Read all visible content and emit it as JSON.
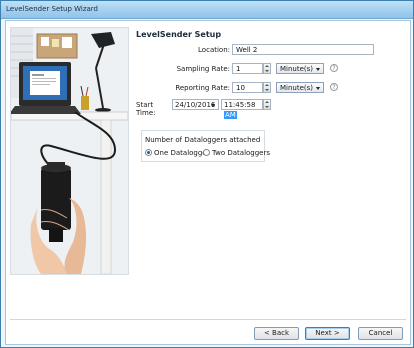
{
  "window": {
    "title": "LevelSender Setup Wizard"
  },
  "page": {
    "heading": "LevelSender Setup"
  },
  "form": {
    "location": {
      "label": "Location:",
      "value": "Well 2"
    },
    "sampling_rate": {
      "label": "Sampling Rate:",
      "value": "1",
      "unit": "Minute(s)"
    },
    "reporting_rate": {
      "label": "Reporting Rate:",
      "value": "10",
      "unit": "Minute(s)"
    },
    "start_time": {
      "label": "Start Time:",
      "date": "24/10/2016",
      "time_prefix": "11:45:58",
      "time_selected": "AM"
    }
  },
  "dataloggers": {
    "group_label": "Number of Dataloggers attached",
    "options": [
      {
        "label": "One Datalogger",
        "selected": true
      },
      {
        "label": "Two Dataloggers",
        "selected": false
      }
    ]
  },
  "buttons": {
    "back": "< Back",
    "next": "Next >",
    "cancel": "Cancel"
  },
  "icons": {
    "help": "?"
  },
  "colors": {
    "accent": "#3c7fb1",
    "selection": "#3399ff"
  }
}
